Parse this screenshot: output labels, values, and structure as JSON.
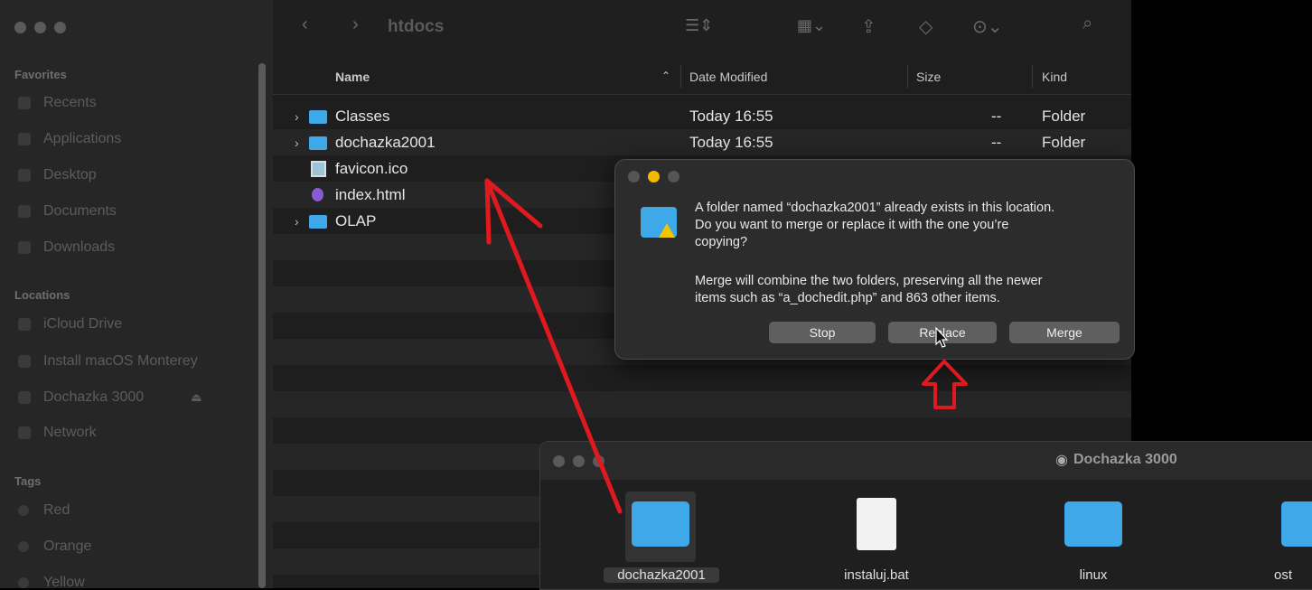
{
  "sidebar": {
    "favorites_header": "Favorites",
    "favorites": [
      "Recents",
      "Applications",
      "Desktop",
      "Documents",
      "Downloads"
    ],
    "locations_header": "Locations",
    "locations": [
      "iCloud Drive",
      "Install macOS Monterey",
      "Dochazka 3000",
      "Network"
    ],
    "tags_header": "Tags",
    "tags": [
      "Red",
      "Orange",
      "Yellow"
    ]
  },
  "toolbar": {
    "title": "htdocs"
  },
  "columns": {
    "name": "Name",
    "date": "Date Modified",
    "size": "Size",
    "kind": "Kind"
  },
  "files": [
    {
      "name": "Classes",
      "date": "Today 16:55",
      "size": "--",
      "kind": "Folder",
      "type": "folder"
    },
    {
      "name": "dochazka2001",
      "date": "Today 16:55",
      "size": "--",
      "kind": "Folder",
      "type": "folder"
    },
    {
      "name": "favicon.ico",
      "type": "image"
    },
    {
      "name": "index.html",
      "type": "html"
    },
    {
      "name": "OLAP",
      "type": "folder"
    }
  ],
  "dialog": {
    "line1": "A folder named “dochazka2001” already exists in this location.",
    "line2": "Do you want to merge or replace it with the one you’re",
    "line3": "copying?",
    "line4": "Merge will combine the two folders, preserving all the newer",
    "line5": "items such as “a_dochedit.php” and 863 other items.",
    "stop": "Stop",
    "replace": "Replace",
    "merge": "Merge"
  },
  "window2": {
    "title": "Dochazka 3000",
    "items": [
      "dochazka2001",
      "instaluj.bat",
      "linux",
      "ost"
    ]
  },
  "colors": {
    "accent_folder": "#3ea8e8",
    "annotation": "#e0191f"
  }
}
